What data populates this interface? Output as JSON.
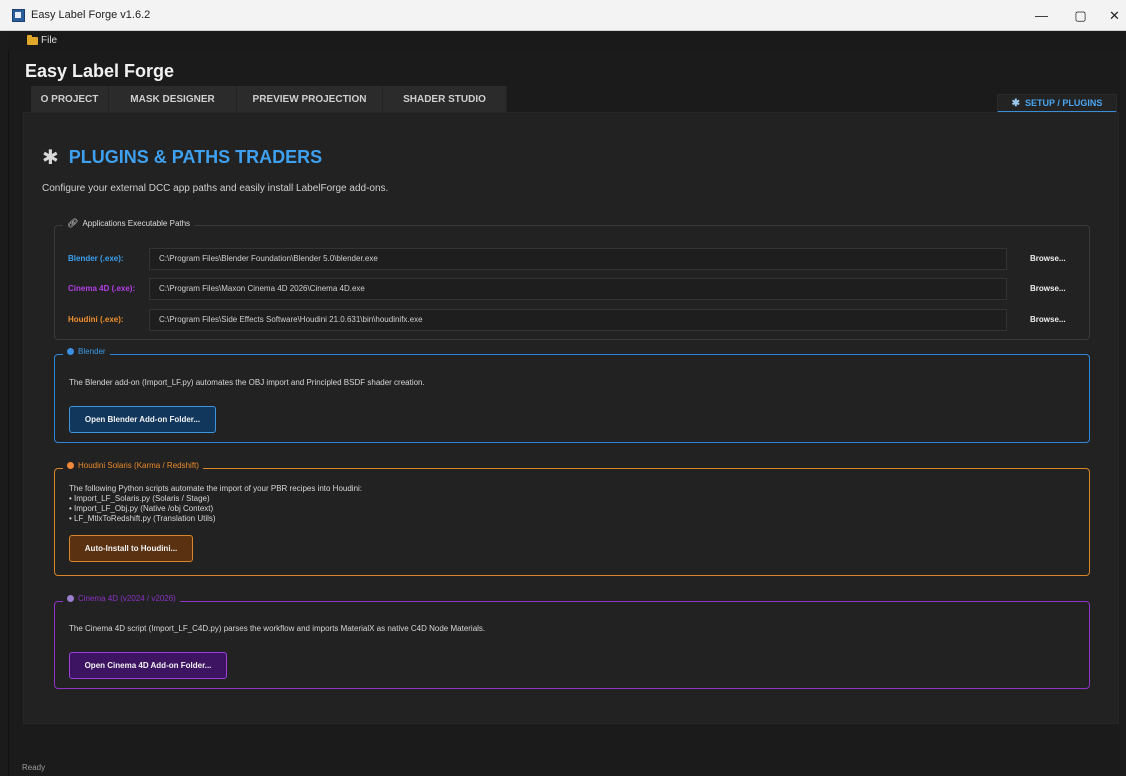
{
  "window": {
    "title": "Easy Label Forge v1.6.2",
    "minimize": "—",
    "maximize": "▢",
    "close": "✕"
  },
  "menu": {
    "file": "File"
  },
  "app": {
    "title": "Easy Label Forge"
  },
  "tabs": [
    {
      "label": "O PROJECT"
    },
    {
      "label": "MASK DESIGNER"
    },
    {
      "label": "PREVIEW PROJECTION"
    },
    {
      "label": "SHADER STUDIO"
    }
  ],
  "setup_tab": {
    "label": "SETUP / PLUGINS"
  },
  "page": {
    "heading": "PLUGINS & PATHS TRADERS",
    "subtitle": "Configure your external DCC app paths and easily install LabelForge add-ons."
  },
  "paths": {
    "group_label": "Applications Executable Paths",
    "browse_label": "Browse...",
    "rows": [
      {
        "label": "Blender (.exe):",
        "value": "C:\\Program Files\\Blender Foundation\\Blender 5.0\\blender.exe",
        "color": "#3aa0ee"
      },
      {
        "label": "Cinema 4D (.exe):",
        "value": "C:\\Program Files\\Maxon Cinema 4D 2026\\Cinema 4D.exe",
        "color": "#b23fe6"
      },
      {
        "label": "Houdini (.exe):",
        "value": "C:\\Program Files\\Side Effects Software\\Houdini 21.0.631\\bin\\houdinifx.exe",
        "color": "#f0902e"
      }
    ]
  },
  "blender": {
    "group_label": "Blender",
    "color": "#2d86d8",
    "description": "The Blender add-on (Import_LF.py) automates the OBJ import and Principled BSDF shader creation.",
    "button": "Open Blender Add-on Folder..."
  },
  "houdini": {
    "group_label": "Houdini Solaris (Karma / Redshift)",
    "color": "#d9862a",
    "description_lines": [
      "The following Python scripts automate the import of your PBR recipes into Houdini:",
      "• Import_LF_Solaris.py (Solaris / Stage)",
      "• Import_LF_Obj.py (Native /obj Context)",
      "• LF_MtlxToRedshift.py (Translation Utils)"
    ],
    "button": "Auto-Install to Houdini..."
  },
  "c4d": {
    "group_label": "Cinema 4D (v2024 / v2026)",
    "color": "#8e32c8",
    "description": "The Cinema 4D script (Import_LF_C4D.py) parses the workflow and imports MaterialX as native C4D Node Materials.",
    "button": "Open Cinema 4D Add-on Folder..."
  },
  "status": {
    "text": "Ready"
  },
  "icons": {
    "app": "app-icon",
    "folder": "folder-icon",
    "gear": "gear-icon",
    "link": "link-icon"
  }
}
